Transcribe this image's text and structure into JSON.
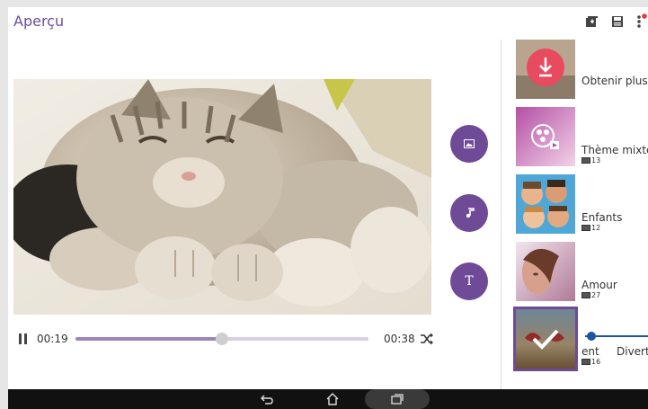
{
  "header": {
    "title": "Aperçu"
  },
  "toolbar": {
    "icons": [
      "add-to-album-icon",
      "save-icon",
      "more-options-icon"
    ],
    "notification_color": "#e53935"
  },
  "side_actions": [
    {
      "name": "image-button",
      "icon": "image-icon"
    },
    {
      "name": "music-button",
      "icon": "music-note-icon"
    },
    {
      "name": "text-button",
      "label": "T"
    }
  ],
  "player": {
    "current_time": "00:19",
    "total_time": "00:38",
    "progress": 0.5,
    "accent": "#6f4a96"
  },
  "themes": [
    {
      "name": "Obtenir plus...",
      "count": ""
    },
    {
      "name": "Thème mixte",
      "count": "13"
    },
    {
      "name": "Enfants",
      "count": "12"
    },
    {
      "name": "Amour",
      "count": "27"
    },
    {
      "name": "ent",
      "name2": "Diverti",
      "count": "16",
      "selected": true
    }
  ],
  "navigation": {
    "buttons": [
      "back-icon",
      "home-icon",
      "recent-apps-icon"
    ]
  }
}
